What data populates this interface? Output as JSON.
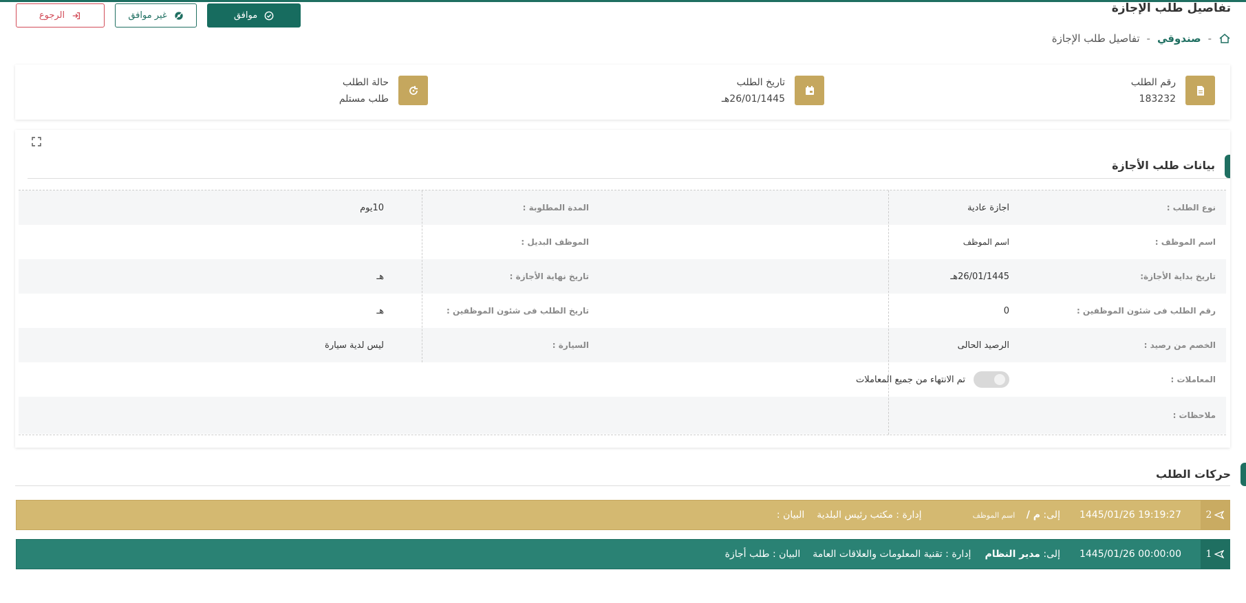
{
  "header": {
    "page_title": "تفاصيل طلب الإجازة",
    "approve_label": "موافق",
    "reject_label": "غير موافق",
    "back_label": "الرجوع"
  },
  "breadcrumb": {
    "home_icon": "home-icon",
    "link": "صندوقي",
    "separator": "-",
    "current": "تفاصيل طلب الإجازة"
  },
  "summary": {
    "request_number": {
      "label": "رقم الطلب",
      "value": "183232",
      "icon": "document-icon"
    },
    "request_date": {
      "label": "تاريخ الطلب",
      "value": "26/01/1445هـ",
      "icon": "calendar-icon"
    },
    "request_status": {
      "label": "حالة الطلب",
      "value": "طلب مستلم",
      "icon": "refresh-icon"
    }
  },
  "details": {
    "title": "بيانات طلب الأجازة",
    "rows": [
      {
        "label1": "نوع الطلب :",
        "value1": "اجازة عادية",
        "label2": "المدة المطلوبة :",
        "value2": "10يوم"
      },
      {
        "label1": "اسم الموظف :",
        "value1": "اسم الموظف",
        "label2": "الموظف البديل :",
        "value2": ""
      },
      {
        "label1": "تاريخ بداية الأجازة:",
        "value1": "26/01/1445هـ",
        "label2": "تاريخ نهاية الأجازة :",
        "value2": "هـ"
      },
      {
        "label1": "رقم الطلب فى شئون الموظفين :",
        "value1": "0",
        "label2": "تاريخ الطلب فى شئون الموظفين :",
        "value2": "هـ"
      },
      {
        "label1": "الخصم من رصيد :",
        "value1": "الرصيد الحالى",
        "label2": "السيارة :",
        "value2": "ليس لدية سيارة"
      }
    ],
    "transactions_label": "المعاملات :",
    "transactions_toggle_text": "تم الانتهاء من جميع المعاملات",
    "transactions_toggle_on": false,
    "notes_label": "ملاحظات :",
    "notes_value": ""
  },
  "movements": {
    "title": "حركات الطلب",
    "items": [
      {
        "number": "2",
        "datetime": "1445/01/26 19:19:27",
        "to_label": "إلى:",
        "to_value": "م /",
        "to_name": "اسم الموظف",
        "department": "إدارة : مكتب رئيس البلدية",
        "statement": "البيان :",
        "color": "#d4b971"
      },
      {
        "number": "1",
        "datetime": "1445/01/26 00:00:00",
        "to_label": "إلى:",
        "to_value": "مدير النظام",
        "to_name": "",
        "department": "إدارة : تقنية المعلومات والعلاقات العامة",
        "statement": "البيان : طلب أجازة",
        "color": "#2a8274"
      }
    ]
  },
  "colors": {
    "primary": "#1f6f61",
    "gold": "#c5a75e",
    "danger": "#d24b57"
  }
}
